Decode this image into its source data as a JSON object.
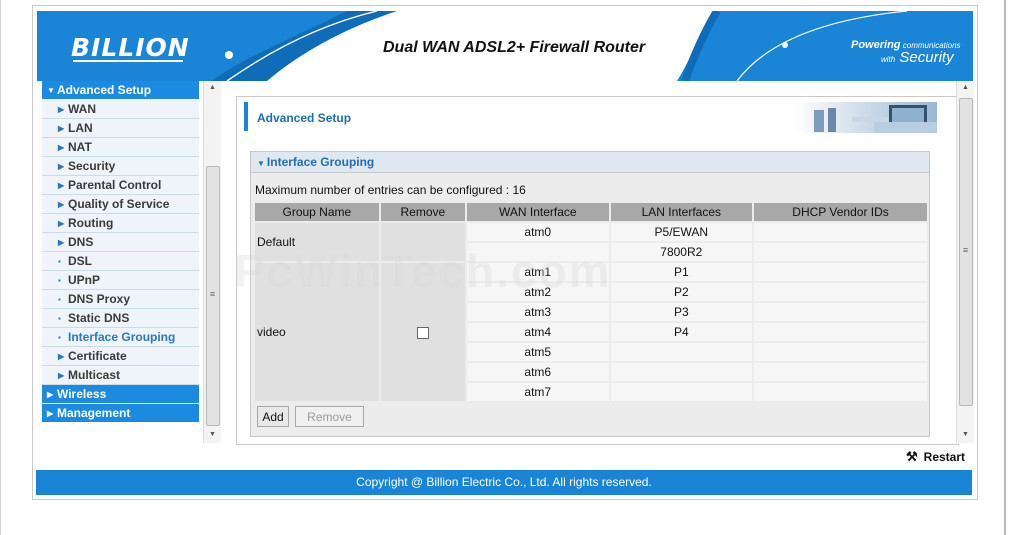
{
  "header": {
    "logo": "BILLION",
    "title": "Dual WAN ADSL2+ Firewall Router",
    "slogan_line1_a": "Powering",
    "slogan_line1_b": " communications",
    "slogan_line2_a": "with",
    "slogan_line2_b": " Security"
  },
  "sidebar": {
    "advanced_setup": "Advanced Setup",
    "items": [
      "WAN",
      "LAN",
      "NAT",
      "Security",
      "Parental Control",
      "Quality of Service",
      "Routing",
      "DNS",
      "DSL",
      "UPnP",
      "DNS Proxy",
      "Static DNS",
      "Interface Grouping",
      "Certificate",
      "Multicast"
    ],
    "active_item": "Interface Grouping",
    "wireless": "Wireless",
    "management": "Management"
  },
  "content": {
    "section_title": "Advanced Setup",
    "panel_title": "Interface Grouping",
    "max_entries": "Maximum number of entries can be configured : 16",
    "columns": [
      "Group Name",
      "Remove",
      "WAN Interface",
      "LAN Interfaces",
      "DHCP Vendor IDs"
    ],
    "groups": [
      {
        "name": "Default",
        "rows": [
          [
            "atm0",
            "P5/EWAN"
          ],
          [
            "",
            "7800R2"
          ]
        ]
      },
      {
        "name": "video",
        "rows": [
          [
            "atm1",
            "P1"
          ],
          [
            "atm2",
            "P2"
          ],
          [
            "atm3",
            "P3"
          ],
          [
            "atm4",
            "P4"
          ],
          [
            "atm5",
            ""
          ],
          [
            "atm6",
            ""
          ],
          [
            "atm7",
            ""
          ]
        ]
      }
    ],
    "add_label": "Add",
    "remove_label": "Remove"
  },
  "watermark": "PcWinTech.com",
  "restart": "Restart",
  "footer": "Copyright @ Billion Electric Co., Ltd. All rights reserved.",
  "colors": {
    "brand_blue": "#1a85d6",
    "title_blue": "#1e6fb5"
  }
}
